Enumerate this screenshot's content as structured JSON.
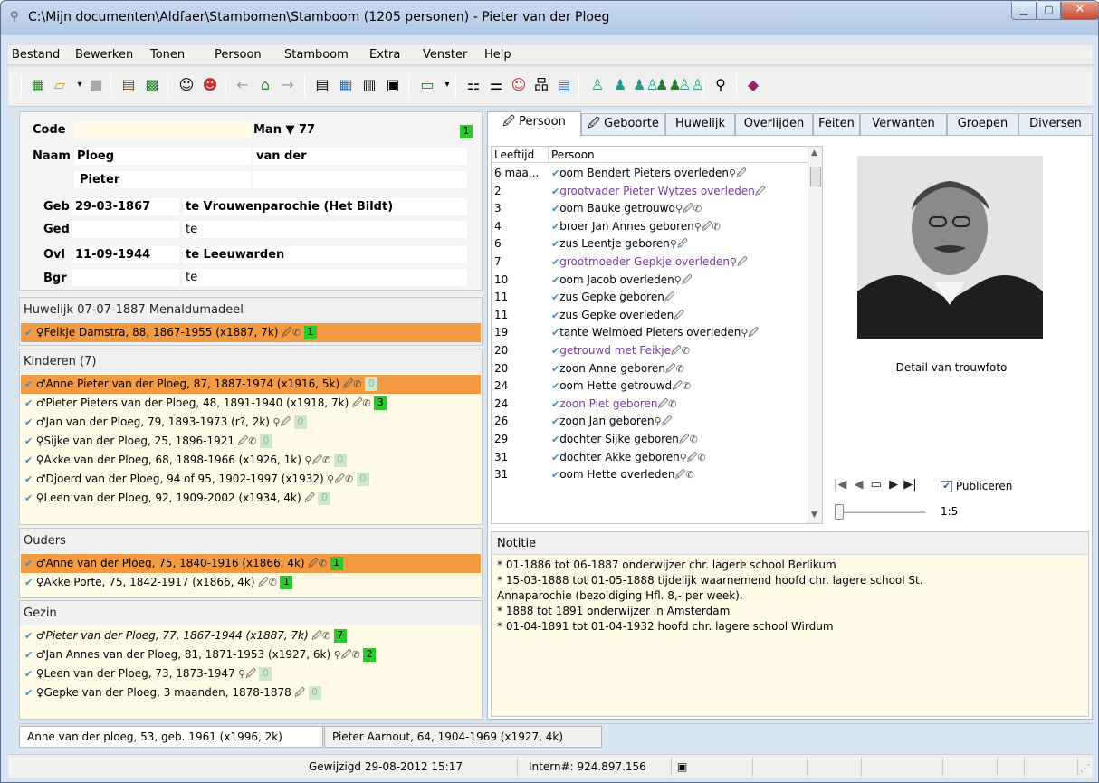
{
  "window": {
    "title": "C:\\Mijn documenten\\Aldfaer\\Stambomen\\Stamboom (1205 personen) - Pieter van der Ploeg"
  },
  "menu": [
    "Bestand",
    "Bewerken",
    "Tonen",
    "Persoon",
    "Stamboom",
    "Extra",
    "Venster",
    "Help"
  ],
  "person": {
    "code_label": "Code",
    "code_value": "",
    "sex": "Man ▼ 77",
    "badge": "1",
    "name_label": "Naam",
    "surname": "Ploeg",
    "prefix": "van der",
    "given": "Pieter",
    "geb_label": "Geb",
    "geb_date": "29-03-1867",
    "geb_place": "te Vrouwenparochie (Het Bildt)",
    "ged_label": "Ged",
    "ged_place": "te",
    "ovl_label": "Ovl",
    "ovl_date": "11-09-1944",
    "ovl_place": "te Leeuwarden",
    "bgr_label": "Bgr",
    "bgr_place": "te"
  },
  "marriage": {
    "title": "Huwelijk 07-07-1887 Menaldumadeel",
    "partner": "♀Feikje Damstra, 88, 1867-1955 (x1887, 7k)",
    "badge": "1"
  },
  "children": {
    "title": "Kinderen (7)",
    "items": [
      {
        "text": "♂Anne Pieter van der Ploeg, 87, 1887-1974 (x1916, 5k)",
        "icons": "🖉✆",
        "badge": "0",
        "badge_type": "p",
        "hl": true
      },
      {
        "text": "♂Pieter Pieters van der Ploeg, 48, 1891-1940 (x1918, 7k)",
        "icons": "🖉✆",
        "badge": "3",
        "badge_type": "g",
        "hl": false
      },
      {
        "text": "♂Jan van der Ploeg, 79, 1893-1973 (r?, 2k)",
        "icons": "⚲🖉",
        "badge": "0",
        "badge_type": "p",
        "hl": false
      },
      {
        "text": "♀Sijke van der Ploeg, 25, 1896-1921",
        "icons": "🖉✆",
        "badge": "0",
        "badge_type": "p",
        "hl": false
      },
      {
        "text": "♀Akke van der Ploeg, 68, 1898-1966 (x1926, 1k)",
        "icons": "⚲🖉✆",
        "badge": "0",
        "badge_type": "p",
        "hl": false
      },
      {
        "text": "♂Djoerd van der Ploeg, 94 of 95, 1902-1997 (x1932)",
        "icons": "⚲🖉✆",
        "badge": "0",
        "badge_type": "p",
        "hl": false
      },
      {
        "text": "♀Leen van der Ploeg, 92, 1909-2002 (x1934, 4k)",
        "icons": "🖉",
        "badge": "0",
        "badge_type": "p",
        "hl": false
      }
    ]
  },
  "parents": {
    "title": "Ouders",
    "items": [
      {
        "text": "♂Anne van der Ploeg, 75, 1840-1916 (x1866, 4k)",
        "icons": "🖉✆",
        "badge": "1",
        "badge_type": "g",
        "hl": true
      },
      {
        "text": "♀Akke Porte, 75, 1842-1917 (x1866, 4k)",
        "icons": "🖉✆",
        "badge": "1",
        "badge_type": "g",
        "hl": false
      }
    ]
  },
  "family": {
    "title": "Gezin",
    "items": [
      {
        "text": "♂Pieter van der Ploeg, 77, 1867-1944 (x1887, 7k)",
        "icons": "🖉✆",
        "badge": "7",
        "badge_type": "g",
        "hl": false
      },
      {
        "text": "♂Jan Annes van der Ploeg, 81, 1871-1953 (x1927, 6k)",
        "icons": "⚲🖉✆",
        "badge": "2",
        "badge_type": "g",
        "hl": false
      },
      {
        "text": "♀Leen van der Ploeg, 73, 1873-1947",
        "icons": "⚲🖉",
        "badge": "0",
        "badge_type": "p",
        "hl": false
      },
      {
        "text": "♀Gepke van der Ploeg, 3 maanden, 1878-1878",
        "icons": "🖉",
        "badge": "0",
        "badge_type": "p",
        "hl": false
      }
    ]
  },
  "tabs": [
    "Persoon",
    "Geboorte",
    "Huwelijk",
    "Overlijden",
    "Feiten",
    "Verwanten",
    "Groepen",
    "Diversen"
  ],
  "events": {
    "col_age": "Leeftijd",
    "col_person": "Persoon",
    "rows": [
      {
        "age": "6 maa...",
        "text": "oom Bendert Pieters overleden",
        "icons": "⚲🖉",
        "purple": false
      },
      {
        "age": "2",
        "text": "grootvader Pieter Wytzes overleden",
        "icons": "🖉",
        "purple": true
      },
      {
        "age": "3",
        "text": "oom Bauke getrouwd",
        "icons": "⚲🖉✆",
        "purple": false
      },
      {
        "age": "4",
        "text": "broer Jan Annes geboren",
        "icons": "⚲🖉✆",
        "purple": false
      },
      {
        "age": "6",
        "text": "zus Leentje geboren",
        "icons": "⚲🖉",
        "purple": false
      },
      {
        "age": "7",
        "text": "grootmoeder Gepkje overleden",
        "icons": "⚲🖉",
        "purple": true
      },
      {
        "age": "10",
        "text": "oom Jacob overleden",
        "icons": "⚲🖉",
        "purple": false
      },
      {
        "age": "11",
        "text": "zus Gepke geboren",
        "icons": "🖉",
        "purple": false
      },
      {
        "age": "11",
        "text": "zus Gepke overleden",
        "icons": "🖉",
        "purple": false
      },
      {
        "age": "19",
        "text": "tante Welmoed Pieters overleden",
        "icons": "⚲🖉",
        "purple": false
      },
      {
        "age": "20",
        "text": "getrouwd met Feikje",
        "icons": "🖉✆",
        "purple": true
      },
      {
        "age": "20",
        "text": "zoon Anne geboren",
        "icons": "🖉✆",
        "purple": false
      },
      {
        "age": "24",
        "text": "oom Hette getrouwd",
        "icons": "🖉✆",
        "purple": false
      },
      {
        "age": "24",
        "text": "zoon Piet geboren",
        "icons": "🖉✆",
        "purple": true
      },
      {
        "age": "26",
        "text": "zoon Jan geboren",
        "icons": "⚲🖉",
        "purple": false
      },
      {
        "age": "29",
        "text": "dochter Sijke geboren",
        "icons": "🖉✆",
        "purple": false
      },
      {
        "age": "31",
        "text": "dochter Akke geboren",
        "icons": "⚲🖉✆",
        "purple": false
      },
      {
        "age": "31",
        "text": "oom Hette overleden",
        "icons": "🖉✆",
        "purple": false
      }
    ]
  },
  "photo": {
    "caption": "Detail van trouwfoto",
    "publish": "Publiceren",
    "zoom": "1:5"
  },
  "notitie": {
    "title": "Notitie",
    "text": "* 01-1886 tot 06-1887 onderwijzer chr. lagere school Berlikum\n* 15-03-1888 tot 01-05-1888 tijdelijk waarnemend hoofd chr. lagere school St.\nAnnaparochie (bezoldiging Hfl. 8,- per week).\n* 1888 tot 1891 onderwijzer in Amsterdam\n* 01-04-1891 tot 01-04-1932 hoofd chr. lagere school Wirdum"
  },
  "bottom_tabs": [
    "Anne van der ploeg, 53, geb. 1961 (x1996, 2k)",
    "Pieter Aarnout, 64, 1904-1969 (x1927, 4k)"
  ],
  "status": {
    "modified": "Gewijzigd 29-08-2012 15:17",
    "intern": "Intern#: 924.897.156"
  }
}
